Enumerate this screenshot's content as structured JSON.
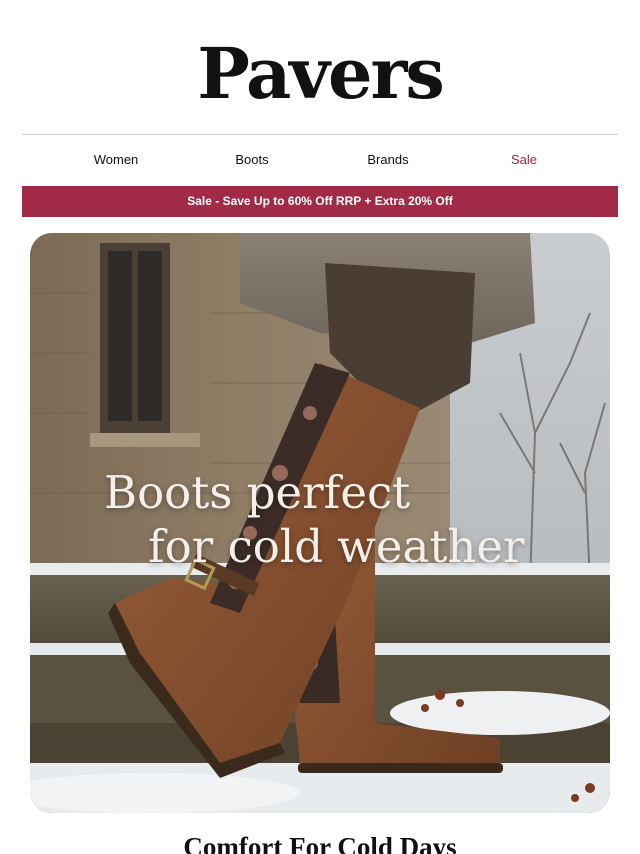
{
  "brand": {
    "logo_text": "Pavers"
  },
  "nav": {
    "items": [
      {
        "label": "Women"
      },
      {
        "label": "Boots"
      },
      {
        "label": "Brands"
      },
      {
        "label": "Sale"
      }
    ]
  },
  "banner": {
    "text": "Sale - Save Up to 60% Off RRP + Extra 20% Off"
  },
  "hero": {
    "line1": "Boots perfect",
    "line2": "for cold weather"
  },
  "section": {
    "heading": "Comfort For Cold Days"
  },
  "colors": {
    "accent": "#a12a46",
    "sale_link": "#9b2340"
  }
}
